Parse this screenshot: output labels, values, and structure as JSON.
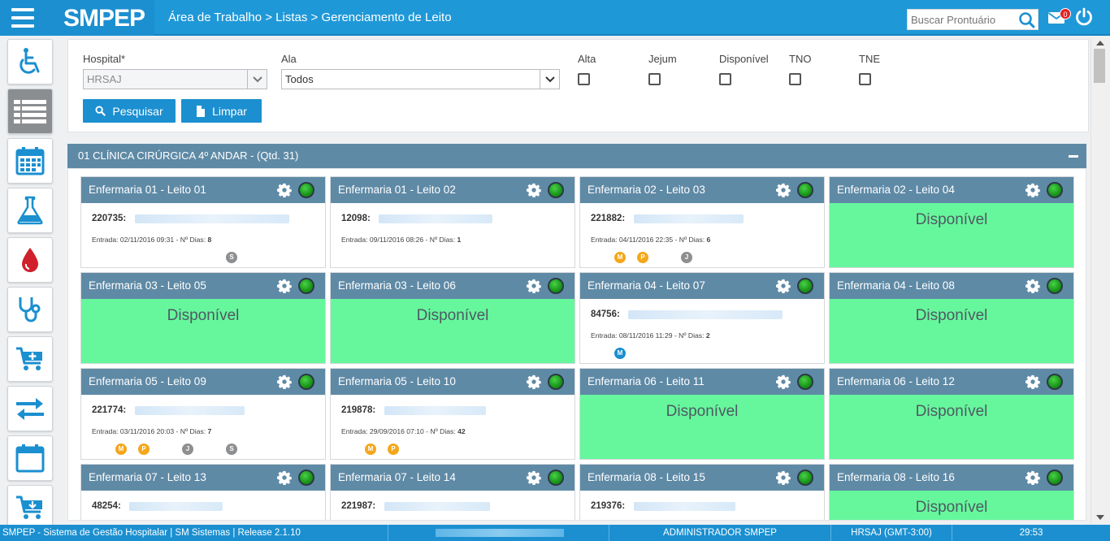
{
  "header": {
    "app_name": "SMPEP",
    "breadcrumb": "Área de Trabalho > Listas > Gerenciamento de Leito",
    "search_placeholder": "Buscar Prontuário",
    "mail_count": "0"
  },
  "sidebar": {
    "items": [
      {
        "icon": "wheelchair-icon"
      },
      {
        "icon": "list-icon"
      },
      {
        "icon": "calendar-grid-icon"
      },
      {
        "icon": "flask-icon"
      },
      {
        "icon": "blood-drop-icon"
      },
      {
        "icon": "stethoscope-icon"
      },
      {
        "icon": "cart-plus-icon"
      },
      {
        "icon": "transfer-icon"
      },
      {
        "icon": "calendar-icon"
      },
      {
        "icon": "cart-download-icon"
      }
    ]
  },
  "filters": {
    "hospital_label": "Hospital*",
    "hospital_value": "HRSAJ",
    "ala_label": "Ala",
    "ala_value": "Todos",
    "checkboxes": [
      {
        "label": "Alta",
        "checked": false
      },
      {
        "label": "Jejum",
        "checked": false
      },
      {
        "label": "Disponível",
        "checked": false
      },
      {
        "label": "TNO",
        "checked": false
      },
      {
        "label": "TNE",
        "checked": false
      }
    ],
    "search_button": "Pesquisar",
    "clear_button": "Limpar"
  },
  "ward": {
    "title": "01 CLÍNICA CIRÚRGICA 4º ANDAR - (Qtd. 31)",
    "available_text": "Disponível",
    "entry_prefix": "Entrada: ",
    "days_label": " - Nº Dias: ",
    "beds": [
      {
        "title": "Enfermaria 01 - Leito 01",
        "status": "occupied",
        "pid": "220735:",
        "entry": "02/11/2016 09:31",
        "days": "8",
        "badges": [
          "S"
        ]
      },
      {
        "title": "Enfermaria 01 - Leito 02",
        "status": "occupied",
        "pid": "12098:",
        "entry": "09/11/2016 08:26",
        "days": "1",
        "badges": []
      },
      {
        "title": "Enfermaria 02 - Leito 03",
        "status": "occupied",
        "pid": "221882:",
        "entry": "04/11/2016 22:35",
        "days": "6",
        "badges": [
          "M",
          "P",
          "J"
        ]
      },
      {
        "title": "Enfermaria 02 - Leito 04",
        "status": "available"
      },
      {
        "title": "Enfermaria 03 - Leito 05",
        "status": "available"
      },
      {
        "title": "Enfermaria 03 - Leito 06",
        "status": "available"
      },
      {
        "title": "Enfermaria 04 - Leito 07",
        "status": "occupied",
        "pid": "84756:",
        "entry": "08/11/2016 11:29",
        "days": "2",
        "badges": [
          "M"
        ]
      },
      {
        "title": "Enfermaria 04 - Leito 08",
        "status": "available"
      },
      {
        "title": "Enfermaria 05 - Leito 09",
        "status": "occupied",
        "pid": "221774:",
        "entry": "03/11/2016 20:03",
        "days": "7",
        "badges": [
          "M",
          "P",
          "J",
          "S"
        ]
      },
      {
        "title": "Enfermaria 05 - Leito 10",
        "status": "occupied",
        "pid": "219878:",
        "entry": "29/09/2016 07:10",
        "days": "42",
        "badges": [
          "M",
          "P"
        ]
      },
      {
        "title": "Enfermaria 06 - Leito 11",
        "status": "available"
      },
      {
        "title": "Enfermaria 06 - Leito 12",
        "status": "available"
      },
      {
        "title": "Enfermaria 07 - Leito 13",
        "status": "occupied",
        "pid": "48254:"
      },
      {
        "title": "Enfermaria 07 - Leito 14",
        "status": "occupied",
        "pid": "221987:"
      },
      {
        "title": "Enfermaria 08 - Leito 15",
        "status": "occupied",
        "pid": "219376:"
      },
      {
        "title": "Enfermaria 08 - Leito 16",
        "status": "available"
      }
    ]
  },
  "statusbar": {
    "system": "SMPEP - Sistema de Gestão Hospitalar | SM Sistemas | Release 2.1.10",
    "user": "ADMINISTRADOR SMPEP",
    "timezone": "HRSAJ (GMT-3:00)",
    "timer": "29:53"
  },
  "colors": {
    "brand_blue": "#1b8fd0",
    "ward_header": "#5f8aa6",
    "available_green": "#66f79c",
    "badge_orange": "#f4a71b",
    "badge_gray": "#8d8f91"
  }
}
